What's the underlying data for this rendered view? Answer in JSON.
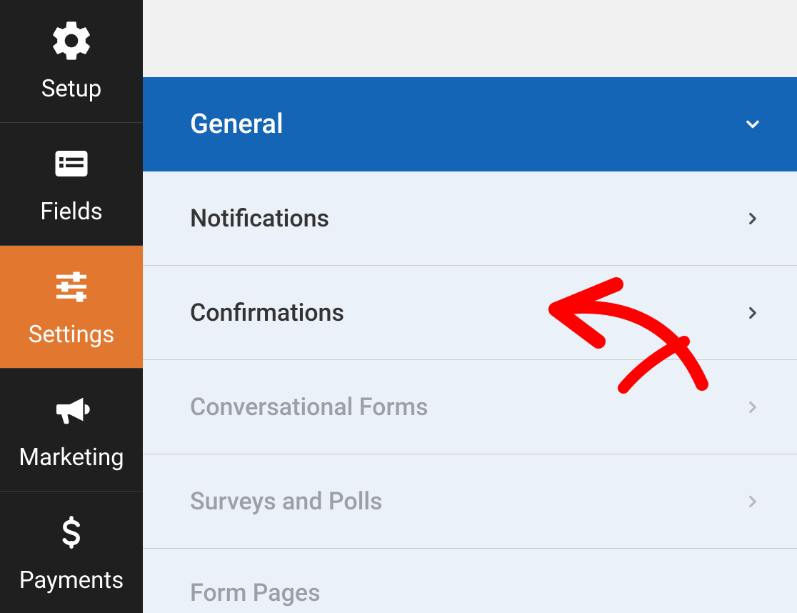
{
  "sidebar": {
    "items": [
      {
        "label": "Setup",
        "icon": "gear-icon",
        "active": false
      },
      {
        "label": "Fields",
        "icon": "list-icon",
        "active": false
      },
      {
        "label": "Settings",
        "icon": "sliders-icon",
        "active": true
      },
      {
        "label": "Marketing",
        "icon": "bullhorn-icon",
        "active": false
      },
      {
        "label": "Payments",
        "icon": "dollar-icon",
        "active": false
      }
    ]
  },
  "settings": {
    "items": [
      {
        "label": "General",
        "active": true,
        "disabled": false
      },
      {
        "label": "Notifications",
        "active": false,
        "disabled": false
      },
      {
        "label": "Confirmations",
        "active": false,
        "disabled": false,
        "highlighted": true
      },
      {
        "label": "Conversational Forms",
        "active": false,
        "disabled": true
      },
      {
        "label": "Surveys and Polls",
        "active": false,
        "disabled": true
      },
      {
        "label": "Form Pages",
        "active": false,
        "disabled": true
      }
    ]
  },
  "colors": {
    "sidebar_bg": "#1f1f1f",
    "sidebar_active": "#e27730",
    "panel_active": "#1565b7",
    "panel_bg": "#eaf1f8",
    "text_dark": "#333333",
    "text_muted": "#9aa0a6",
    "annotation": "#ff0000"
  }
}
